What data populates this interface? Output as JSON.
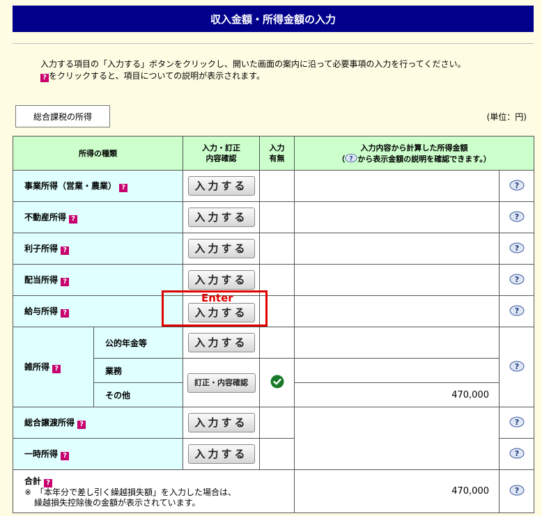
{
  "header": {
    "title": "収入金額・所得金額の入力"
  },
  "instructions": {
    "line1": "入力する項目の「入力する」ボタンをクリックし、開いた画面の案内に沿って必要事項の入力を行ってください。",
    "line2": "をクリックすると、項目についての説明が表示されます。"
  },
  "tab": {
    "label": "総合課税の所得"
  },
  "unit": "(単位：円)",
  "table": {
    "col_type": "所得の種類",
    "col_input_1": "入力・訂正",
    "col_input_2": "内容確認",
    "col_status_1": "入力",
    "col_status_2": "有無",
    "col_amount_1": "入力内容から計算した所得金額",
    "col_amount_2a": "（",
    "col_amount_2b": "から表示金額の説明を確認できます。）",
    "rows": [
      {
        "label": "事業所得（営業・農業）",
        "button": "入力する",
        "amount": ""
      },
      {
        "label": "不動産所得",
        "button": "入力する",
        "amount": ""
      },
      {
        "label": "利子所得",
        "button": "入力する",
        "amount": ""
      },
      {
        "label": "配当所得",
        "button": "入力する",
        "amount": ""
      },
      {
        "label": "給与所得",
        "button": "入力する",
        "amount": ""
      }
    ],
    "misc": {
      "label": "雑所得",
      "sub1": "公的年金等",
      "sub2": "業務",
      "sub3": "その他",
      "button1": "入力する",
      "button2": "訂正・内容確認",
      "amount": "470,000"
    },
    "rows2": [
      {
        "label": "総合譲渡所得",
        "button": "入力する"
      },
      {
        "label": "一時所得",
        "button": "入力する"
      }
    ],
    "total": {
      "label": "合計",
      "note1": "※　「本年分で差し引く繰越損失額」を入力した場合は、",
      "note2": "繰越損失控除後の金額が表示されています。",
      "amount": "470,000"
    }
  },
  "annotation": {
    "label": "Enter",
    "color": "#e00000"
  },
  "qicon_glyph": "?",
  "colors": {
    "title_bg": "#00008b",
    "header_bg": "#ccffcc",
    "label_bg": "#e0ffff",
    "page_bg": "#fefde3"
  }
}
